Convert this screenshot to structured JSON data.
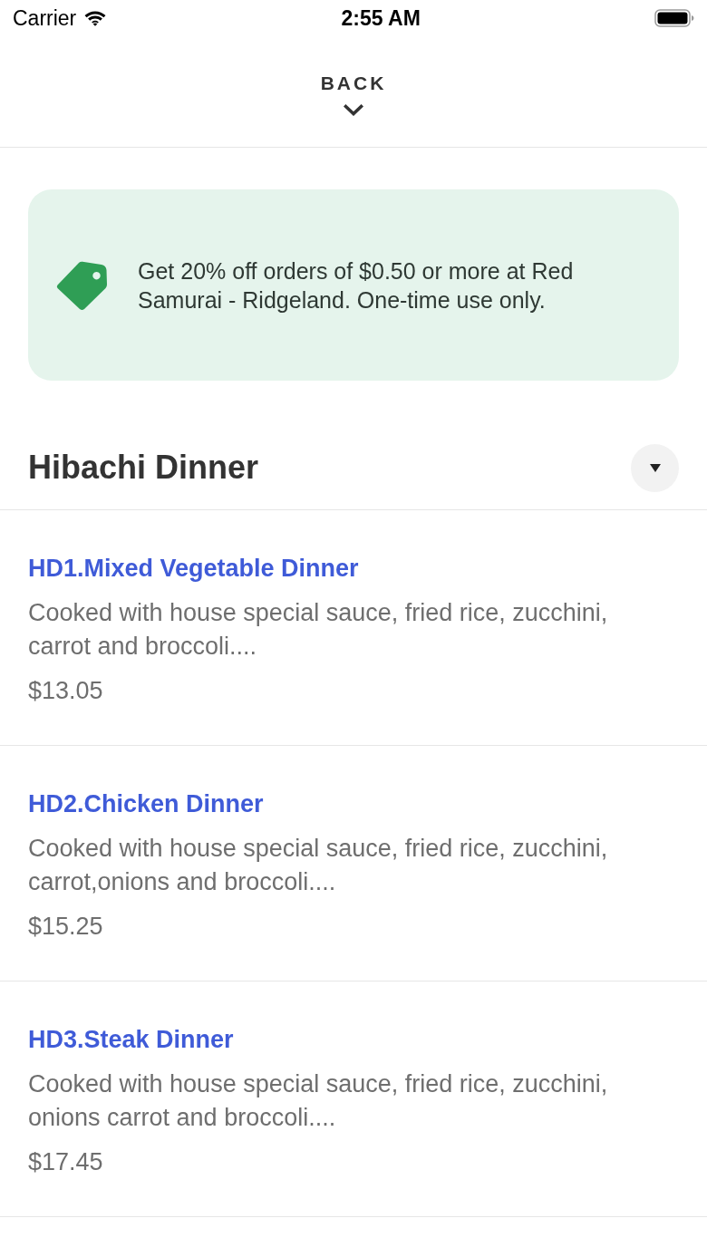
{
  "status_bar": {
    "carrier": "Carrier",
    "time": "2:55 AM"
  },
  "header": {
    "back_label": "BACK"
  },
  "promo": {
    "text": "Get 20% off orders of $0.50 or more at Red Samurai - Ridgeland. One-time use only."
  },
  "section": {
    "title": "Hibachi Dinner"
  },
  "items": [
    {
      "name": "HD1.Mixed Vegetable Dinner",
      "description": "Cooked with house special sauce, fried rice, zucchini, carrot and broccoli....",
      "price": "$13.05"
    },
    {
      "name": "HD2.Chicken Dinner",
      "description": "Cooked with house special sauce, fried rice, zucchini, carrot,onions and broccoli....",
      "price": "$15.25"
    },
    {
      "name": "HD3.Steak Dinner",
      "description": "Cooked with house special sauce, fried rice, zucchini, onions carrot and broccoli....",
      "price": "$17.45"
    }
  ]
}
